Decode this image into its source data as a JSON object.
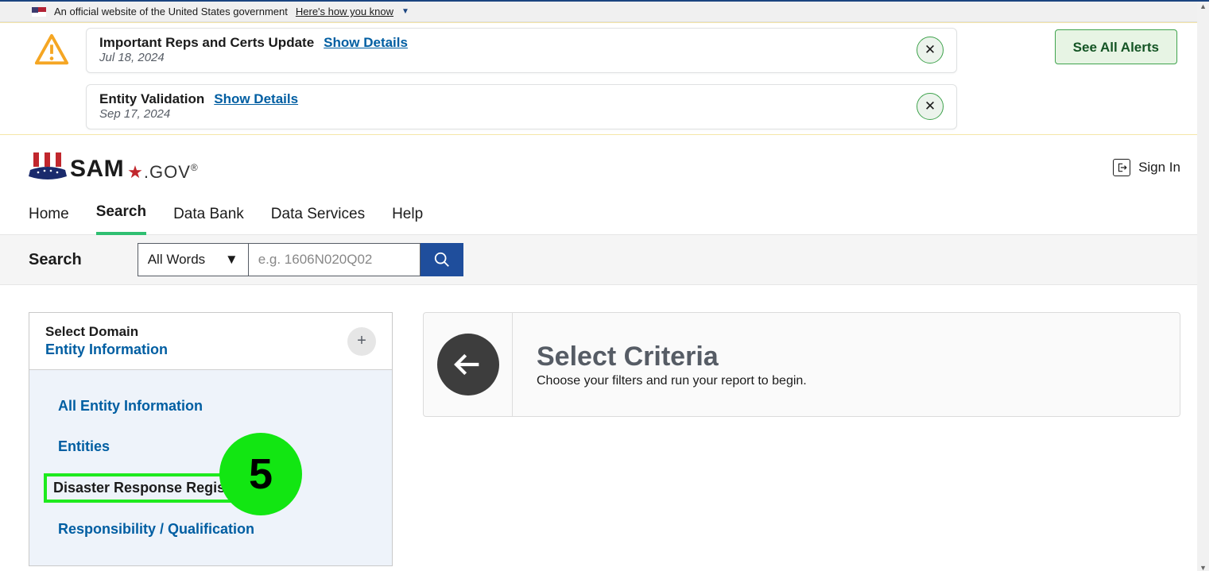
{
  "gov_banner": {
    "text": "An official website of the United States government",
    "link": "Here's how you know"
  },
  "alerts": [
    {
      "title": "Important Reps and Certs Update",
      "details_label": "Show Details",
      "date": "Jul 18, 2024"
    },
    {
      "title": "Entity Validation",
      "details_label": "Show Details",
      "date": "Sep 17, 2024"
    }
  ],
  "see_all_label": "See All Alerts",
  "logo": {
    "main": "SAM",
    "suffix": ".GOV",
    "reg": "®"
  },
  "signin_label": "Sign In",
  "nav": {
    "items": [
      "Home",
      "Search",
      "Data Bank",
      "Data Services",
      "Help"
    ],
    "active_index": 1
  },
  "searchbar": {
    "label": "Search",
    "select_value": "All Words",
    "placeholder": "e.g. 1606N020Q02"
  },
  "sidebar": {
    "head_label": "Select Domain",
    "head_value": "Entity Information",
    "items": [
      "All Entity Information",
      "Entities",
      "Disaster Response Registry",
      "Responsibility / Qualification"
    ],
    "selected_index": 2
  },
  "criteria": {
    "title": "Select Criteria",
    "subtitle": "Choose your filters and run your report to begin."
  },
  "annotation": {
    "badge": "5"
  }
}
